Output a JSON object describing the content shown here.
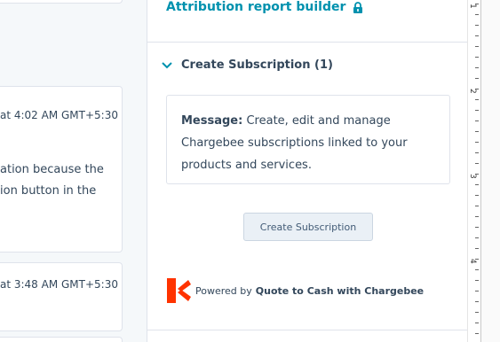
{
  "timeline": {
    "card1_timestamp": "at 4:02 AM GMT+5:30",
    "card1_line1": "ation because the",
    "card1_line2": "ion button in the",
    "card2_timestamp": "at 3:48 AM GMT+5:30"
  },
  "sidebar": {
    "attribution_link": "Attribution report builder",
    "section_title": "Create Subscription (1)",
    "message_label": "Message:",
    "message_text": "Create, edit and manage Chargebee subscriptions linked to your products and services.",
    "create_button_label": "Create Subscription",
    "powered_by_prefix": "Powered by",
    "powered_by_name": "Quote to Cash with Chargebee"
  },
  "ruler": {
    "labels": [
      "1",
      "2",
      "3",
      "4"
    ]
  },
  "colors": {
    "link": "#0091ae",
    "chargebee_brand": "#ff3300",
    "button_bg": "#eaf0f6",
    "border": "#dfe3eb"
  }
}
